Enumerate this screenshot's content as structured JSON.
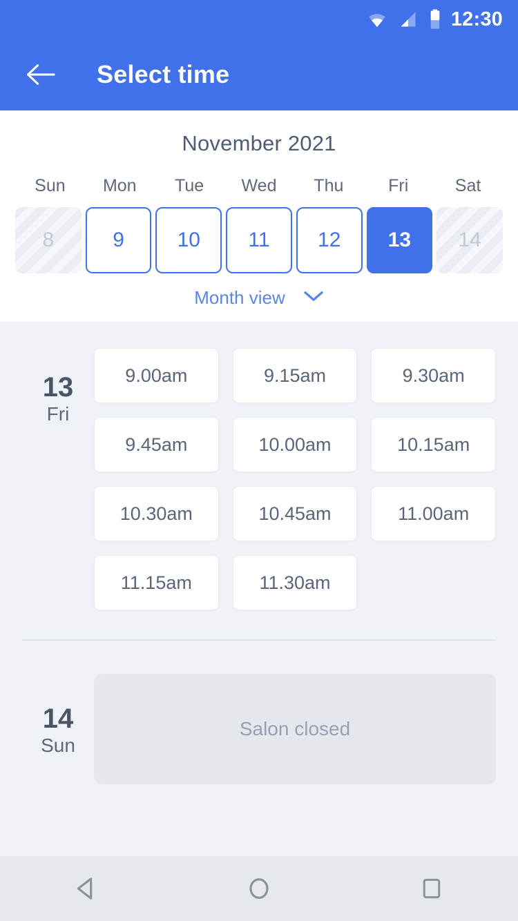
{
  "status_bar": {
    "time": "12:30",
    "icons": [
      "wifi-icon",
      "signal-icon",
      "battery-icon"
    ]
  },
  "app_bar": {
    "back_icon": "arrow-left-icon",
    "title": "Select time"
  },
  "calendar": {
    "month_title": "November 2021",
    "weekdays": [
      "Sun",
      "Mon",
      "Tue",
      "Wed",
      "Thu",
      "Fri",
      "Sat"
    ],
    "days": [
      {
        "number": "8",
        "state": "disabled"
      },
      {
        "number": "9",
        "state": "enabled"
      },
      {
        "number": "10",
        "state": "enabled"
      },
      {
        "number": "11",
        "state": "enabled"
      },
      {
        "number": "12",
        "state": "enabled"
      },
      {
        "number": "13",
        "state": "selected"
      },
      {
        "number": "14",
        "state": "disabled"
      }
    ],
    "month_view_label": "Month view",
    "month_view_icon": "chevron-down-icon"
  },
  "schedule": [
    {
      "day_number": "13",
      "day_name": "Fri",
      "slots": [
        "9.00am",
        "9.15am",
        "9.30am",
        "9.45am",
        "10.00am",
        "10.15am",
        "10.30am",
        "10.45am",
        "11.00am",
        "11.15am",
        "11.30am"
      ]
    },
    {
      "day_number": "14",
      "day_name": "Sun",
      "closed_message": "Salon closed"
    }
  ],
  "nav_bar": {
    "back": "nav-back-icon",
    "home": "nav-home-icon",
    "recents": "nav-recents-icon"
  },
  "colors": {
    "accent": "#4070ea",
    "header_bg": "#4070ea",
    "page_bg": "#eff2f7",
    "card_bg": "#ffffff",
    "text_dark": "#4a5568",
    "text_muted": "#5e6878",
    "disabled_bg": "#eaeef4",
    "closed_bg": "#e4e8ed",
    "nav_bg": "#e5e8ec"
  }
}
